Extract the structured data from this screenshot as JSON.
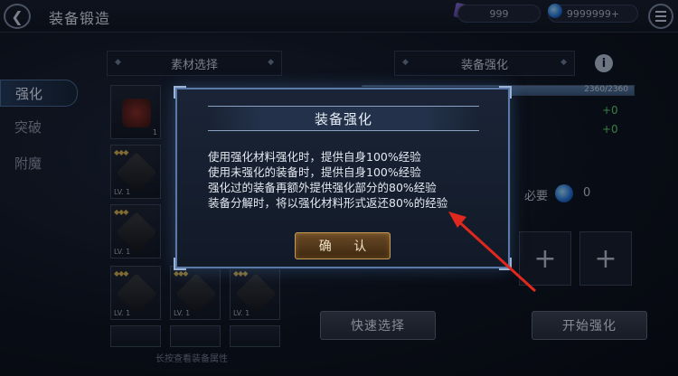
{
  "header": {
    "back_icon": "back-arrow-icon",
    "title": "装备锻造",
    "currency1_icon": "crystal-icon",
    "currency1_value": "999",
    "currency2_icon": "mana-orb-icon",
    "currency2_value": "9999999+",
    "menu_icon": "hamburger-menu-icon"
  },
  "tabs": [
    {
      "label": "强化",
      "active": true
    },
    {
      "label": "突破",
      "active": false
    },
    {
      "label": "附魔",
      "active": false
    }
  ],
  "material_panel": {
    "title": "素材选择",
    "first_item_count": "1",
    "slot_level": "LV. 1",
    "hint": "长按查看装备属性"
  },
  "enhance_panel": {
    "title": "装备强化",
    "info_icon": "info-icon",
    "exp_text": "2360/2360",
    "exp_progress": 1.0,
    "plus_values": [
      "+0",
      "+0"
    ],
    "need_label": "必要",
    "need_value": "0",
    "quick_select_label": "快速选择",
    "start_label": "开始强化",
    "plus_icon": "plus-icon"
  },
  "modal": {
    "title": "装备强化",
    "lines": [
      "使用强化材料强化时，提供自身100%经验",
      "使用未强化的装备时，提供自身100%经验",
      "强化过的装备再额外提供强化部分的80%经验",
      "装备分解时，将以强化材料形式返还80%的经验"
    ],
    "confirm_label": "确 认"
  },
  "colors": {
    "accent_green": "#5fd36a",
    "arrow_red": "#e0281e",
    "modal_border": "#5a79a8",
    "confirm_gold": "#c79a52"
  }
}
